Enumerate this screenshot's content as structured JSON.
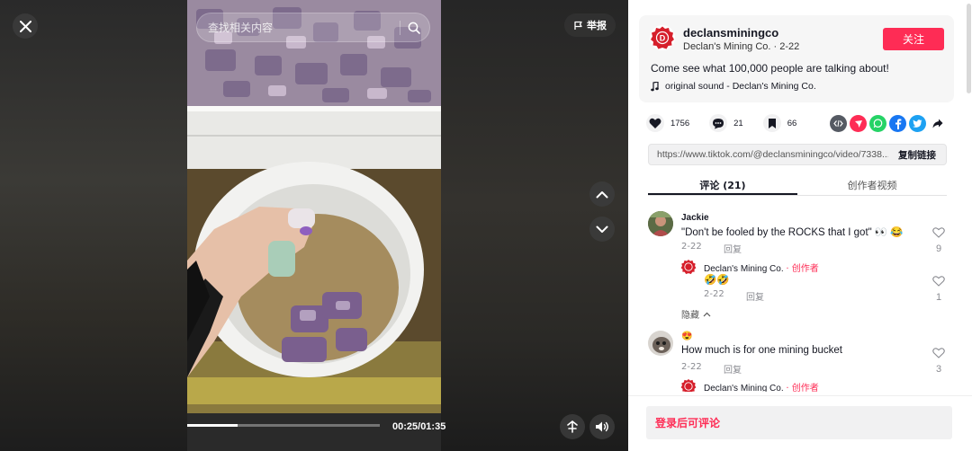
{
  "video": {
    "search_placeholder": "查找相关内容",
    "report_label": "举报",
    "time": "00:25/01:35",
    "progress": 0.263
  },
  "author": {
    "username": "declansminingco",
    "display_name": "Declan's Mining Co.",
    "sep": " · ",
    "date": "2-22",
    "follow_label": "关注",
    "avatar_letter": "D",
    "description": "Come see what 100,000 people are talking about!",
    "music": "original sound - Declan's Mining Co."
  },
  "actions": {
    "likes": "1756",
    "comments": "21",
    "saves": "66"
  },
  "share_link": {
    "url": "https://www.tiktok.com/@declansminingco/video/7338...",
    "copy_label": "复制链接"
  },
  "tabs": [
    {
      "label": "评论 (21)"
    },
    {
      "label": "创作者视频"
    }
  ],
  "comments": [
    {
      "author": "Jackie",
      "text": "\"Don't be fooled by the ROCKS that I got\" 👀 😂",
      "date": "2-22",
      "reply_label": "回复",
      "likes": "9",
      "replies": [
        {
          "author": "Declan's Mining Co.",
          "creator_tag": "· 创作者",
          "text": "🤣🤣",
          "date": "2-22",
          "reply_label": "回复",
          "likes": "1"
        }
      ],
      "hide_label": "隐藏"
    },
    {
      "author": "😍",
      "text": "How much is for one mining bucket",
      "date": "2-22",
      "reply_label": "回复",
      "likes": "3",
      "replies": [
        {
          "author": "Declan's Mining Co.",
          "creator_tag": "· 创作者"
        }
      ]
    }
  ],
  "login_to_comment": "登录后可评论",
  "colors": {
    "accent": "#fe2c55",
    "text": "#161823",
    "muted": "#8a8b91"
  }
}
